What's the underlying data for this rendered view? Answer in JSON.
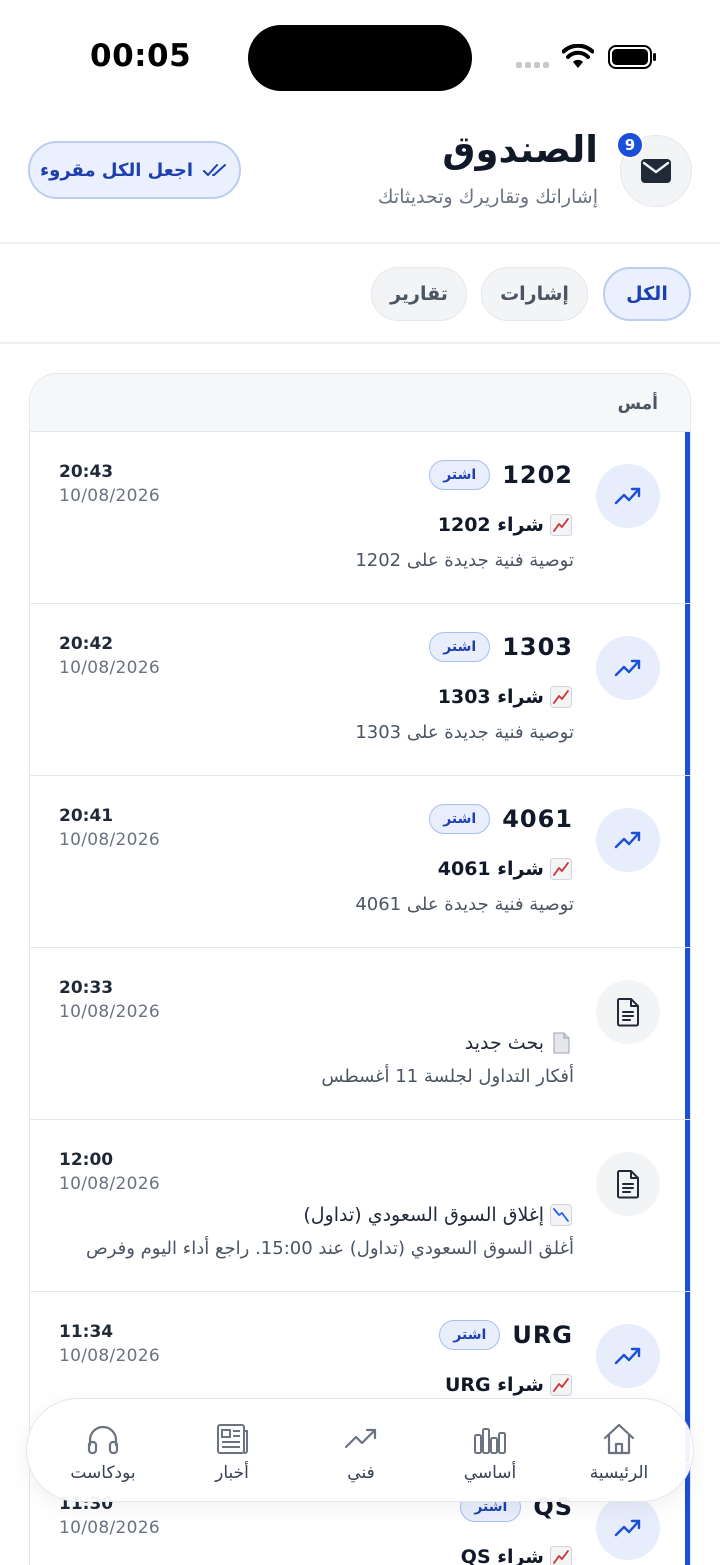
{
  "status_bar": {
    "time": "00:05"
  },
  "header": {
    "title": "الصندوق",
    "subtitle": "إشاراتك وتقاريرك وتحديثاتك",
    "unread_count": "9",
    "mark_all_label": "اجعل الكل مقروء"
  },
  "tabs": [
    {
      "label": "الكل",
      "active": true
    },
    {
      "label": "إشارات",
      "active": false
    },
    {
      "label": "تقارير",
      "active": false
    }
  ],
  "section": {
    "label": "أمس"
  },
  "notifications": [
    {
      "kind": "signal",
      "symbol": "1202",
      "badge": "اشتر",
      "title": "شراء 1202",
      "emoji": "chart-up-icon",
      "description": "توصية فنية جديدة على 1202",
      "time": "20:43",
      "date": "10/08/2026",
      "unread": true
    },
    {
      "kind": "signal",
      "symbol": "1303",
      "badge": "اشتر",
      "title": "شراء 1303",
      "emoji": "chart-up-icon",
      "description": "توصية فنية جديدة على 1303",
      "time": "20:42",
      "date": "10/08/2026",
      "unread": true
    },
    {
      "kind": "signal",
      "symbol": "4061",
      "badge": "اشتر",
      "title": "شراء 4061",
      "emoji": "chart-up-icon",
      "description": "توصية فنية جديدة على 4061",
      "time": "20:41",
      "date": "10/08/2026",
      "unread": true
    },
    {
      "kind": "report",
      "title": "بحث جديد",
      "emoji": "page-icon",
      "description": "أفكار التداول لجلسة 11 أغسطس",
      "time": "20:33",
      "date": "10/08/2026",
      "unread": true
    },
    {
      "kind": "report",
      "title": "إغلاق السوق السعودي (تداول)",
      "emoji": "chart-down-icon",
      "description": "أغلق السوق السعودي (تداول) عند 15:00. راجع أداء اليوم وفرص",
      "time": "12:00",
      "date": "10/08/2026",
      "unread": true
    },
    {
      "kind": "signal",
      "symbol": "URG",
      "badge": "اشتر",
      "title": "شراء URG",
      "emoji": "chart-up-icon",
      "description": "",
      "time": "11:34",
      "date": "10/08/2026",
      "unread": true
    },
    {
      "kind": "signal",
      "symbol": "QS",
      "badge": "اشتر",
      "title": "شراء QS",
      "emoji": "chart-up-icon",
      "description": "",
      "time": "11:30",
      "date": "10/08/2026",
      "unread": true
    }
  ],
  "bottom_nav": [
    {
      "label": "الرئيسية",
      "icon": "home-icon"
    },
    {
      "label": "أساسي",
      "icon": "bar-chart-icon"
    },
    {
      "label": "فني",
      "icon": "trend-icon"
    },
    {
      "label": "أخبار",
      "icon": "newspaper-icon"
    },
    {
      "label": "بودكاست",
      "icon": "headphones-icon"
    }
  ],
  "colors": {
    "accent": "#1a4fd8",
    "accent_light": "#eaf0fd",
    "chart_up": "#d0312d"
  }
}
